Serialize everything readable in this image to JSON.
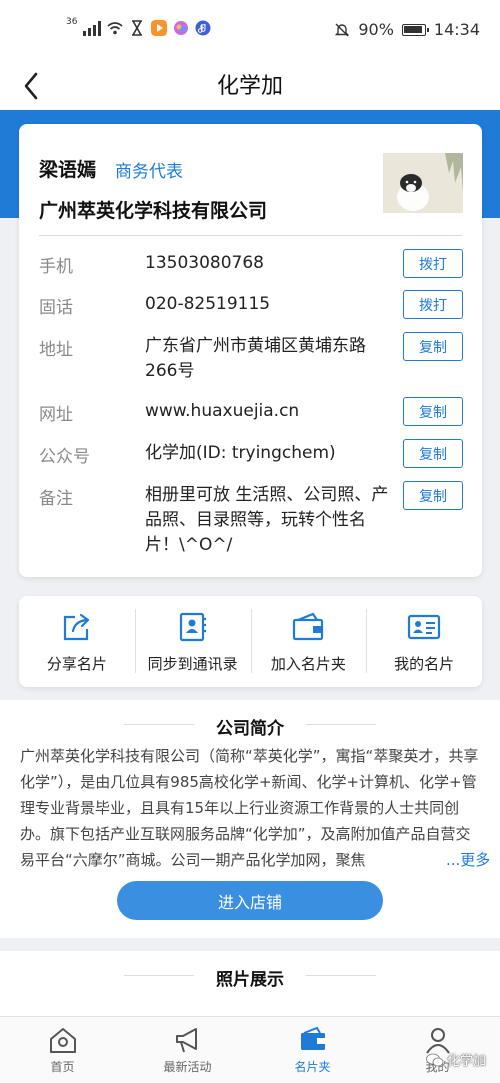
{
  "status_bar": {
    "network_tag": "36",
    "battery": "90%",
    "time": "14:34"
  },
  "nav": {
    "title": "化学加",
    "back_icon": "back-arrow-icon"
  },
  "card": {
    "name": "梁语嫣",
    "role": "商务代表",
    "company": "广州萃英化学科技有限公司",
    "rows": [
      {
        "label": "手机",
        "value": "13503080768",
        "action": "拨打"
      },
      {
        "label": "固话",
        "value": "020-82519115",
        "action": "拨打"
      },
      {
        "label": "地址",
        "value": "广东省广州市黄埔区黄埔东路266号",
        "action": "复制"
      },
      {
        "label": "网址",
        "value": "www.huaxuejia.cn",
        "action": "复制"
      },
      {
        "label": "公众号",
        "value": "化学加(ID: tryingchem)",
        "action": "复制"
      },
      {
        "label": "备注",
        "value": "相册里可放 生活照、公司照、产品照、目录照等，玩转个性名片！\\^O^/",
        "action": "复制"
      }
    ]
  },
  "quick_actions": [
    {
      "label": "分享名片",
      "icon": "share-icon"
    },
    {
      "label": "同步到通讯录",
      "icon": "contacts-sync-icon"
    },
    {
      "label": "加入名片夹",
      "icon": "card-holder-icon"
    },
    {
      "label": "我的名片",
      "icon": "id-card-icon"
    }
  ],
  "intro": {
    "title": "公司简介",
    "text": "广州萃英化学科技有限公司（简称“萃英化学”，寓指“萃聚英才，共享化学”），是由几位具有985高校化学+新闻、化学+计算机、化学+管理专业背景毕业，且具有15年以上行业资源工作背景的人士共同创办。旗下包括产业互联网服务品牌“化学加”，及高附加值产品自营交易平台“六摩尔”商城。公司一期产品化学加网，聚焦",
    "more": "...更多",
    "store_button": "进入店铺"
  },
  "photos": {
    "title": "照片展示"
  },
  "tabbar": [
    {
      "label": "首页",
      "icon": "home-icon",
      "active": false
    },
    {
      "label": "最新活动",
      "icon": "megaphone-icon",
      "active": false
    },
    {
      "label": "名片夹",
      "icon": "wallet-icon",
      "active": true
    },
    {
      "label": "我的",
      "icon": "user-icon",
      "active": false
    }
  ],
  "watermark": "化学加",
  "colors": {
    "accent": "#1f7bd6",
    "button": "#3a8fe0"
  }
}
